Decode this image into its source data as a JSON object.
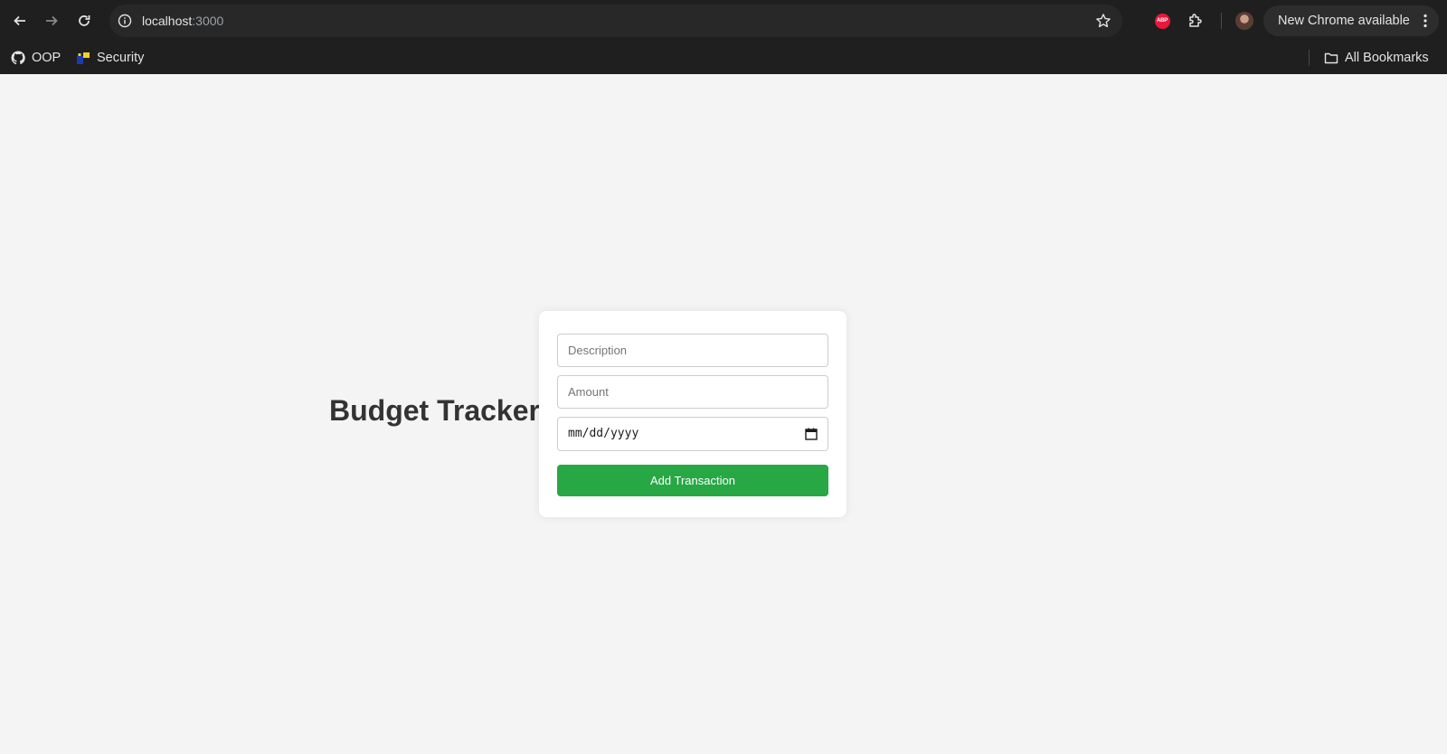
{
  "browser": {
    "url_host": "localhost",
    "url_port": ":3000",
    "update_label": "New Chrome available",
    "abp_label": "ABP",
    "bookmarks": [
      {
        "label": "OOP",
        "icon": "github-icon"
      },
      {
        "label": "Security",
        "icon": "security-favicon-icon"
      }
    ],
    "all_bookmarks_label": "All Bookmarks"
  },
  "app": {
    "title": "Budget Tracker",
    "form": {
      "description_placeholder": "Description",
      "amount_placeholder": "Amount",
      "date_placeholder": "mm/dd/yyyy",
      "submit_label": "Add Transaction"
    }
  },
  "colors": {
    "accent": "#28a745",
    "page_background": "#f4f4f4",
    "browser_chrome": "#1f1f1f"
  }
}
